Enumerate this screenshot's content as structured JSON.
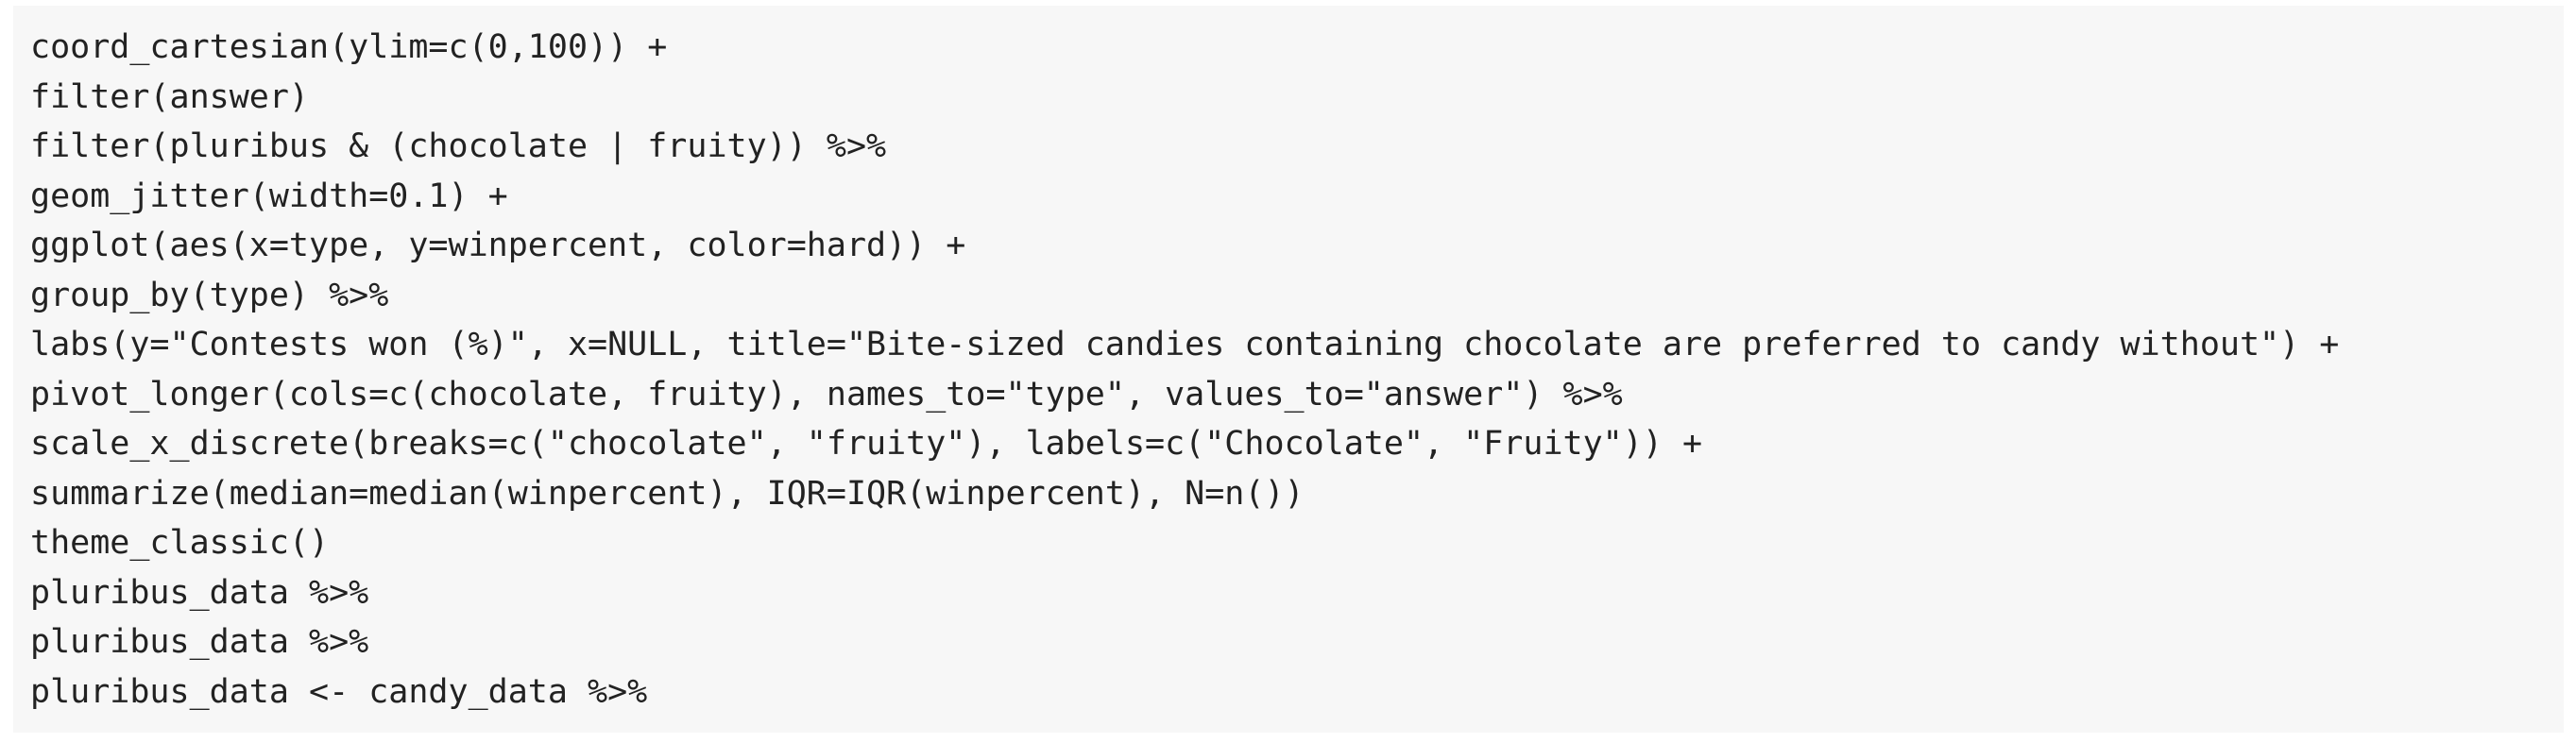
{
  "code_block": {
    "lines": [
      "coord_cartesian(ylim=c(0,100)) +",
      "filter(answer)",
      "filter(pluribus & (chocolate | fruity)) %>%",
      "geom_jitter(width=0.1) +",
      "ggplot(aes(x=type, y=winpercent, color=hard)) +",
      "group_by(type) %>%",
      "labs(y=\"Contests won (%)\", x=NULL, title=\"Bite-sized candies containing chocolate are preferred to candy without\") +",
      "pivot_longer(cols=c(chocolate, fruity), names_to=\"type\", values_to=\"answer\") %>%",
      "scale_x_discrete(breaks=c(\"chocolate\", \"fruity\"), labels=c(\"Chocolate\", \"Fruity\")) +",
      "summarize(median=median(winpercent), IQR=IQR(winpercent), N=n())",
      "theme_classic()",
      "pluribus_data %>%",
      "pluribus_data %>%",
      "pluribus_data <- candy_data %>%"
    ]
  }
}
